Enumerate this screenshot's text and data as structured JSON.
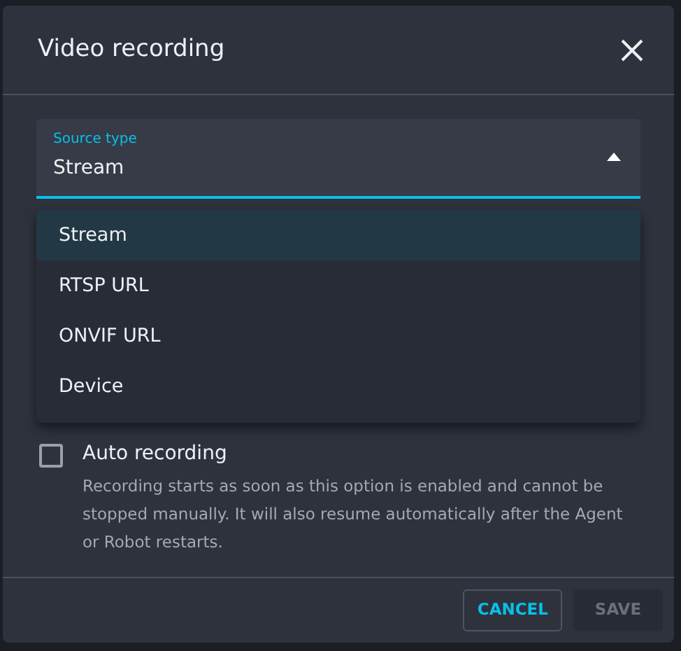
{
  "dialog": {
    "title": "Video recording"
  },
  "source_type": {
    "label": "Source type",
    "value": "Stream",
    "expanded": true,
    "options": [
      {
        "label": "Stream",
        "selected": true
      },
      {
        "label": "RTSP URL",
        "selected": false
      },
      {
        "label": "ONVIF URL",
        "selected": false
      },
      {
        "label": "Device",
        "selected": false
      }
    ]
  },
  "auto_recording": {
    "label": "Auto recording",
    "checked": false,
    "help": "Recording starts as soon as this option is enabled and cannot be stopped manually. It will also resume automatically after the Agent or Robot restarts."
  },
  "buttons": [
    {
      "label": "CANCEL",
      "disabled": false
    },
    {
      "label": "SAVE",
      "disabled": true
    }
  ]
}
